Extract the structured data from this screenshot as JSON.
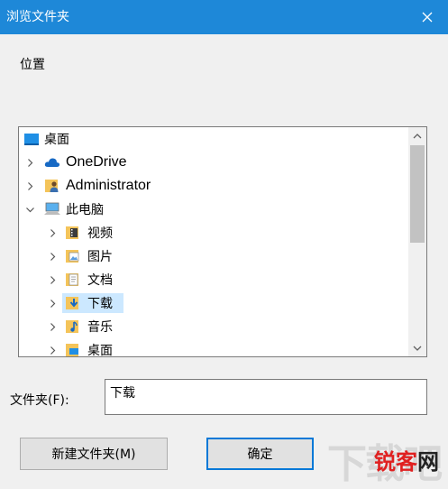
{
  "window": {
    "title": "浏览文件夹",
    "close_icon": "close-icon"
  },
  "location_label": "位置",
  "tree": {
    "items": [
      {
        "label": "桌面",
        "icon": "desktop-icon",
        "indent": 0,
        "chevron": "",
        "selected": false
      },
      {
        "label": "OneDrive",
        "icon": "cloud-icon",
        "indent": 1,
        "chevron": "right",
        "selected": false
      },
      {
        "label": "Administrator",
        "icon": "user-folder-icon",
        "indent": 1,
        "chevron": "right",
        "selected": false
      },
      {
        "label": "此电脑",
        "icon": "computer-icon",
        "indent": 1,
        "chevron": "down",
        "selected": false
      },
      {
        "label": "视频",
        "icon": "video-folder-icon",
        "indent": 2,
        "chevron": "right",
        "selected": false
      },
      {
        "label": "图片",
        "icon": "pictures-folder-icon",
        "indent": 2,
        "chevron": "right",
        "selected": false
      },
      {
        "label": "文档",
        "icon": "documents-folder-icon",
        "indent": 2,
        "chevron": "right",
        "selected": false
      },
      {
        "label": "下载",
        "icon": "downloads-folder-icon",
        "indent": 2,
        "chevron": "right",
        "selected": true
      },
      {
        "label": "音乐",
        "icon": "music-folder-icon",
        "indent": 2,
        "chevron": "right",
        "selected": false
      },
      {
        "label": "桌面",
        "icon": "desktop-folder-icon",
        "indent": 2,
        "chevron": "right",
        "selected": false
      }
    ]
  },
  "folder_field": {
    "label": "文件夹(F):",
    "value": "下载"
  },
  "buttons": {
    "new_folder": "新建文件夹(M)",
    "ok": "确定"
  },
  "watermark": {
    "big": "下载吧",
    "small_red": "锐客",
    "small_dark": "网"
  },
  "colors": {
    "title_bar": "#1e88d8",
    "selection": "#cce8ff",
    "ok_border": "#0078d7"
  }
}
